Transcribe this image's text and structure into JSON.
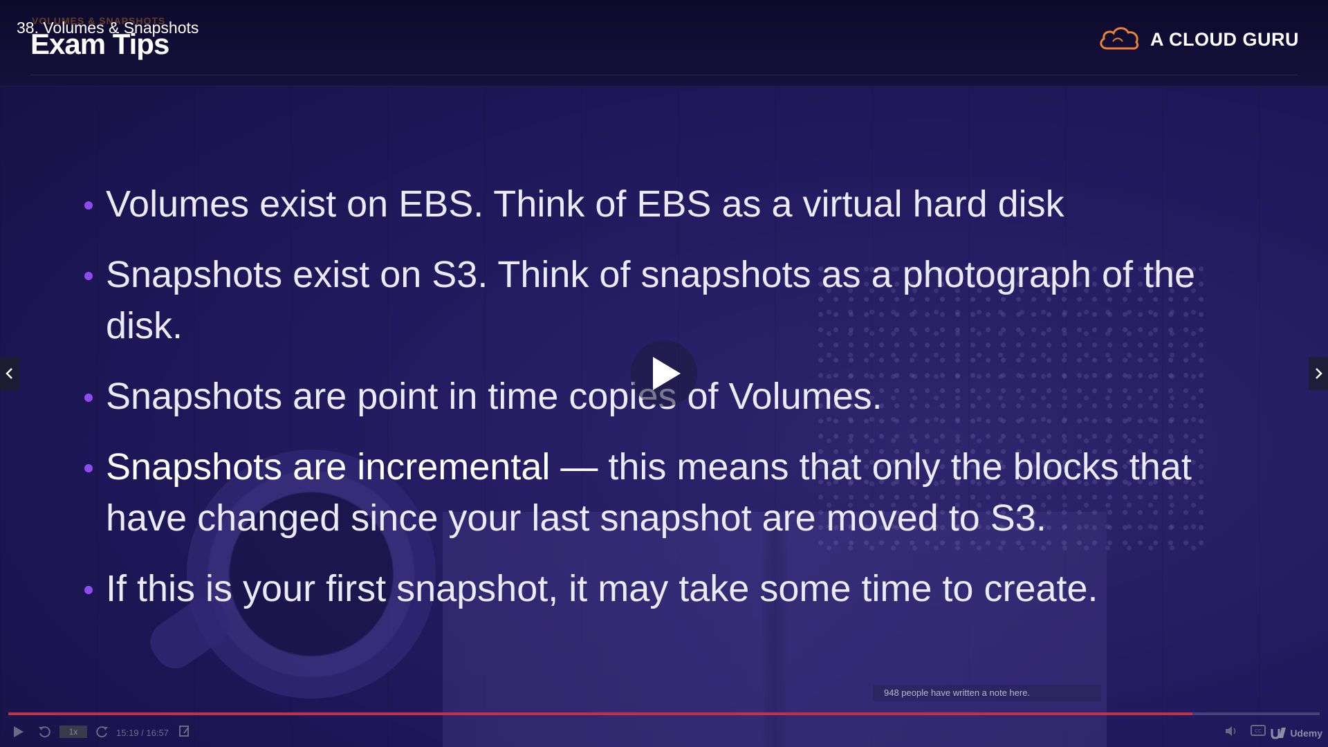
{
  "video": {
    "title": "38. Volumes & Snapshots",
    "current_time": "15:19",
    "duration": "16:57",
    "time_display": "15:19 / 16:57",
    "speed": "1x",
    "progress": 0.903
  },
  "slide": {
    "section_label": "VOLUMES & SNAPSHOTS",
    "title": "Exam Tips",
    "brand": "A CLOUD GURU",
    "bullets": [
      {
        "text": "Volumes exist on EBS. Think of EBS as a virtual hard disk"
      },
      {
        "text": "Snapshots exist on S3. Think of snapshots as a photograph of the disk."
      },
      {
        "text": "Snapshots are point in time copies of Volumes."
      },
      {
        "strong": "Snapshots are incremental — ",
        "text": " this means that only the blocks that have changed since your last snapshot are moved to S3."
      },
      {
        "text": "If this is your first snapshot, it may take some time to create."
      }
    ]
  },
  "notes_tooltip": "948 people have written a note here.",
  "player_brand": "Udemy",
  "colors": {
    "bullet_dot": "#8c4cf0",
    "progress": "#c0324a",
    "brand_cloud": "#e8833a"
  },
  "icons": [
    "play-icon",
    "rewind-icon",
    "forward-icon",
    "note-icon",
    "volume-icon",
    "captions-icon",
    "chevron-left-icon",
    "chevron-right-icon",
    "cloud-logo-icon"
  ]
}
